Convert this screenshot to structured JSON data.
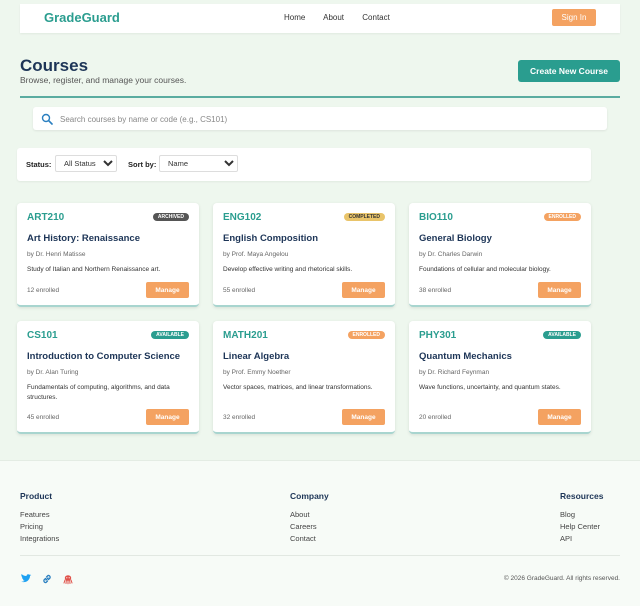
{
  "brand": "GradeGuard",
  "nav": {
    "links": [
      "Home",
      "About",
      "Contact"
    ],
    "signin": "Sign In"
  },
  "page": {
    "title": "Courses",
    "subtitle": "Browse, register, and manage your courses.",
    "create_button": "Create New Course"
  },
  "search": {
    "placeholder": "Search courses by name or code (e.g., CS101)",
    "value": ""
  },
  "filters": {
    "status_label": "Status:",
    "status_value": "All Statuses",
    "sort_label": "Sort by:",
    "sort_value": "Name"
  },
  "colors": {
    "primary": "#2a9d8f",
    "accent": "#f4a261",
    "archived": "#555555",
    "completed": "#e9c46a",
    "enrolled": "#f4a261",
    "available": "#2a9d8f"
  },
  "courses": [
    {
      "code": "ART210",
      "status": "ARCHIVED",
      "title": "Art History: Renaissance",
      "instructor": "by Dr. Henri Matisse",
      "description": "Study of Italian and Northern Renaissance art.",
      "enrolled": "12 enrolled",
      "action": "Manage"
    },
    {
      "code": "ENG102",
      "status": "COMPLETED",
      "title": "English Composition",
      "instructor": "by Prof. Maya Angelou",
      "description": "Develop effective writing and rhetorical skills.",
      "enrolled": "55 enrolled",
      "action": "Manage"
    },
    {
      "code": "BIO110",
      "status": "ENROLLED",
      "title": "General Biology",
      "instructor": "by Dr. Charles Darwin",
      "description": "Foundations of cellular and molecular biology.",
      "enrolled": "38 enrolled",
      "action": "Manage"
    },
    {
      "code": "CS101",
      "status": "AVAILABLE",
      "title": "Introduction to Computer Science",
      "instructor": "by Dr. Alan Turing",
      "description": "Fundamentals of computing, algorithms, and data structures.",
      "enrolled": "45 enrolled",
      "action": "Manage"
    },
    {
      "code": "MATH201",
      "status": "ENROLLED",
      "title": "Linear Algebra",
      "instructor": "by Prof. Emmy Noether",
      "description": "Vector spaces, matrices, and linear transformations.",
      "enrolled": "32 enrolled",
      "action": "Manage"
    },
    {
      "code": "PHY301",
      "status": "AVAILABLE",
      "title": "Quantum Mechanics",
      "instructor": "by Dr. Richard Feynman",
      "description": "Wave functions, uncertainty, and quantum states.",
      "enrolled": "20 enrolled",
      "action": "Manage"
    }
  ],
  "footer": {
    "columns": [
      {
        "heading": "Product",
        "links": [
          "Features",
          "Pricing",
          "Integrations"
        ]
      },
      {
        "heading": "Company",
        "links": [
          "About",
          "Careers",
          "Contact"
        ]
      },
      {
        "heading": "Resources",
        "links": [
          "Blog",
          "Help Center",
          "API"
        ]
      }
    ],
    "social_icons": [
      "twitter-bird-icon",
      "link-icon",
      "octocat-icon"
    ],
    "copyright": "© 2026 GradeGuard. All rights reserved."
  }
}
